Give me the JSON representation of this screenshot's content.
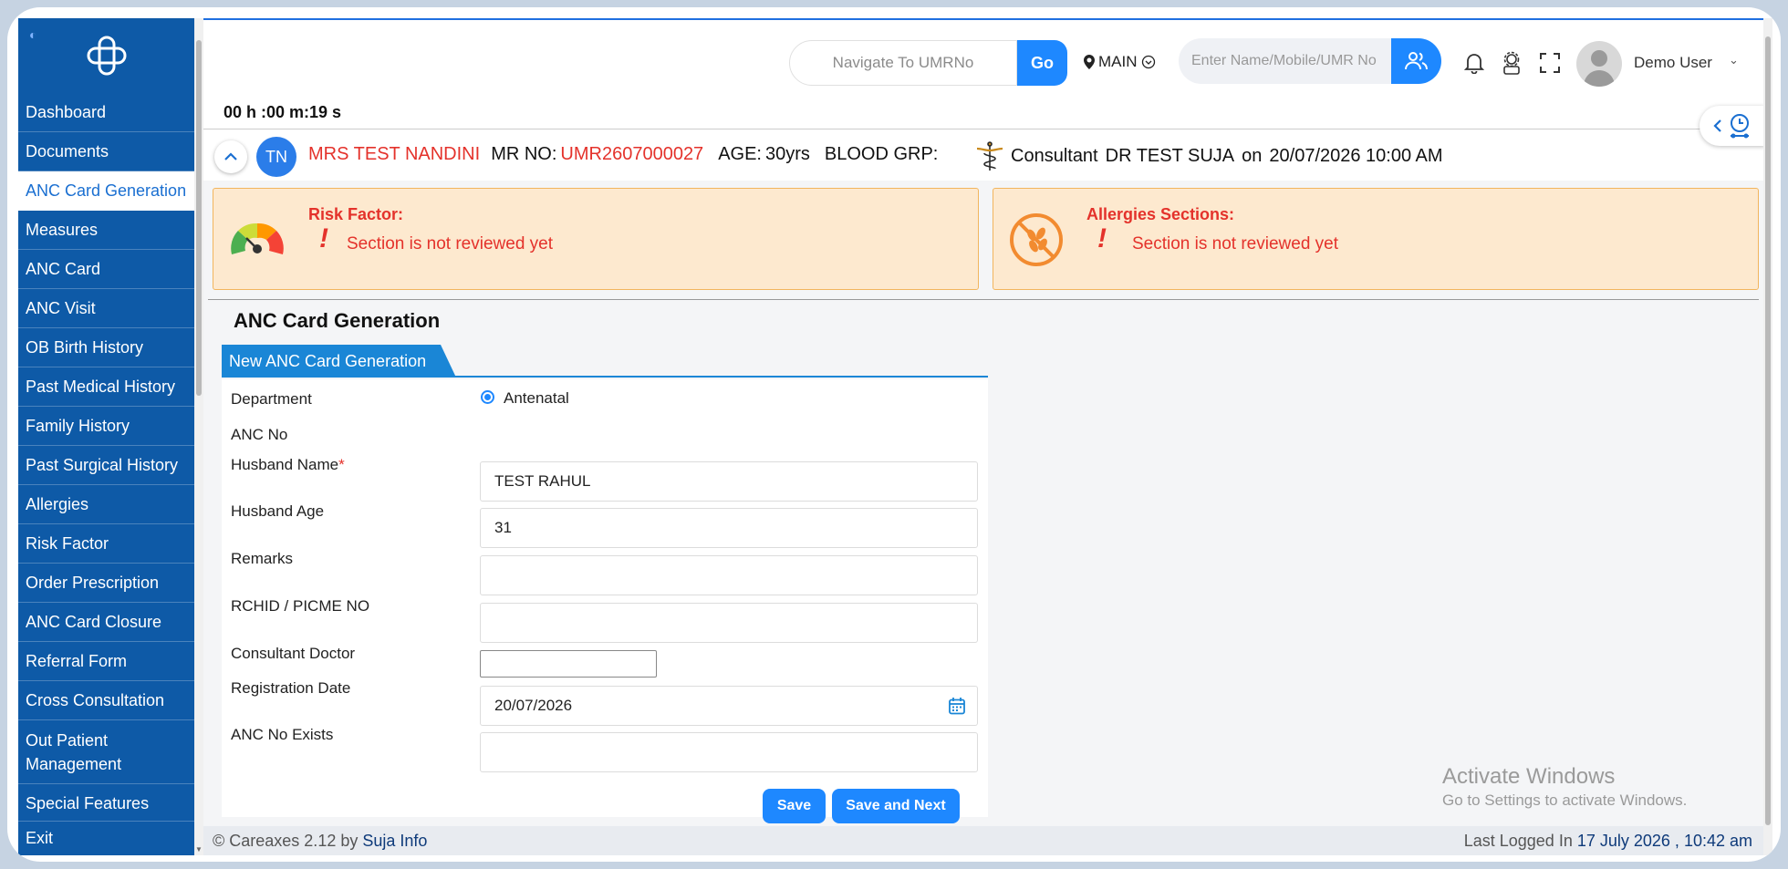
{
  "sidebar": {
    "items": [
      {
        "label": "Dashboard"
      },
      {
        "label": "Documents"
      },
      {
        "label": "ANC Card Generation"
      },
      {
        "label": "Measures"
      },
      {
        "label": "ANC Card"
      },
      {
        "label": "ANC Visit"
      },
      {
        "label": "OB Birth History"
      },
      {
        "label": "Past Medical History"
      },
      {
        "label": "Family History"
      },
      {
        "label": "Past Surgical History"
      },
      {
        "label": "Allergies"
      },
      {
        "label": "Risk Factor"
      },
      {
        "label": "Order Prescription"
      },
      {
        "label": "ANC Card Closure"
      },
      {
        "label": "Referral Form"
      },
      {
        "label": "Cross Consultation"
      },
      {
        "label": "Out Patient Management"
      },
      {
        "label": "Special Features"
      }
    ],
    "active": "ANC Card Generation",
    "exit_label": "Exit"
  },
  "topbar": {
    "umr_placeholder": "Navigate To UMRNo",
    "go_label": "Go",
    "location": "MAIN",
    "search_placeholder": "Enter Name/Mobile/UMR No",
    "username": "Demo User"
  },
  "timer": "00 h :00 m:19 s",
  "patient": {
    "initials": "TN",
    "name": "MRS TEST NANDINI",
    "mr_label": "MR NO:",
    "mr_no": "UMR2607000027",
    "age_label": "AGE:",
    "age": "30yrs",
    "blood_label": "BLOOD GRP:",
    "blood": "",
    "consultant_label": "Consultant",
    "consultant": "DR TEST SUJA",
    "on_label": "on",
    "datetime": "20/07/2026 10:00 AM"
  },
  "alerts": {
    "risk": {
      "title": "Risk Factor:",
      "mark": "!",
      "message": "Section is not reviewed yet"
    },
    "allergy": {
      "title": "Allergies Sections:",
      "mark": "!",
      "message": "Section is not reviewed yet"
    }
  },
  "page": {
    "title": "ANC Card Generation",
    "tab": "New ANC Card Generation"
  },
  "form": {
    "department_label": "Department",
    "department_value": "Antenatal",
    "anc_no_label": "ANC No",
    "husband_name_label": "Husband Name",
    "husband_name_value": "TEST RAHUL",
    "husband_age_label": "Husband Age",
    "husband_age_value": "31",
    "remarks_label": "Remarks",
    "remarks_value": "",
    "rchid_label": "RCHID / PICME NO",
    "rchid_value": "",
    "consultant_label": "Consultant Doctor",
    "reg_date_label": "Registration Date",
    "reg_date_value": "20/07/2026",
    "anc_exists_label": "ANC No Exists",
    "anc_exists_value": "",
    "save_label": "Save",
    "save_next_label": "Save and Next"
  },
  "watermark": {
    "line1": "Activate Windows",
    "line2": "Go to Settings to activate Windows."
  },
  "footer": {
    "copyright": "© Careaxes 2.12 by",
    "company": "Suja Info",
    "last_login_label": "Last Logged In",
    "last_login_value": "17 July 2026 , 10:42 am"
  },
  "colors": {
    "sidebar": "#0e5aa7",
    "accent": "#1e88ff",
    "alert_bg": "#fde9cf",
    "alert_text": "#e4322b"
  }
}
